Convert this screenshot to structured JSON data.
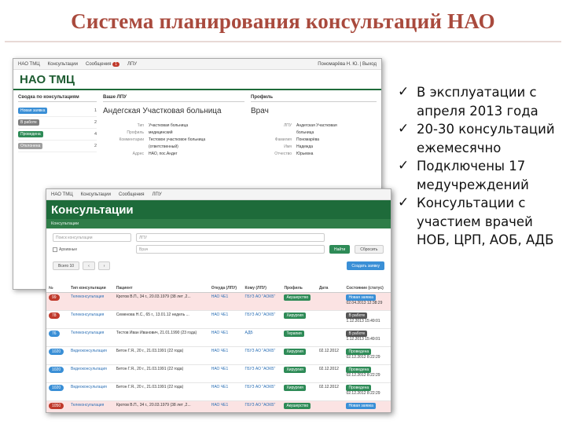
{
  "slide": {
    "title": "Система планирования консультаций НАО"
  },
  "screenshot1": {
    "topbar": {
      "items": [
        "НАО ТМЦ",
        "Консультации",
        "Сообщения",
        "ЛПУ"
      ],
      "messages_count": "1",
      "right": "Пономарёва Н. Ю. | Выход"
    },
    "brand": "НАО ТМЦ",
    "panel_left_title": "Сводка по консультациям",
    "left_rows": [
      {
        "label": "Новая заявка",
        "value": "1",
        "color": "#3a8fd6"
      },
      {
        "label": "В работе",
        "value": "2",
        "color": "#7f7f7f"
      },
      {
        "label": "Проведена",
        "value": "4",
        "color": "#2e8b57"
      },
      {
        "label": "Отклонена",
        "value": "2",
        "color": "#9e9e9e"
      }
    ],
    "panel_mid_title": "Ваше ЛПУ",
    "org_name": "Андегская Участковая больница",
    "org_fields": [
      {
        "k": "Тип",
        "v": "Участковая больница"
      },
      {
        "k": "Профиль",
        "v": "медицинский"
      },
      {
        "k": "Комментарии",
        "v": "Тестовое участковое больница"
      },
      {
        "k": "",
        "v": "(ответственный)"
      },
      {
        "k": "Адрес",
        "v": "НАО, пос.Андег"
      }
    ],
    "panel_right_title": "Профиль",
    "role": "Врач",
    "profile_fields": [
      {
        "k": "ЛПУ",
        "v": "Андегская Участковая"
      },
      {
        "k": "",
        "v": "больница"
      },
      {
        "k": "Фамилия",
        "v": "Пономарёва"
      },
      {
        "k": "Имя",
        "v": "Надежда"
      },
      {
        "k": "Отчество",
        "v": "Юрьевна"
      }
    ]
  },
  "screenshot2": {
    "topbar": {
      "items": [
        "НАО ТМЦ",
        "Консультации",
        "Сообщения",
        "ЛПУ"
      ]
    },
    "brand": "Консультации",
    "subnav": "Консультации",
    "search_placeholder": "Поиск консультации",
    "lpu_placeholder": "ЛПУ",
    "archive_label": "Архивные",
    "doctor_placeholder": "Врач",
    "find_button": "Найти",
    "reset_button": "Сбросить",
    "per_page_label": "Всего 10",
    "add_button": "Создать заявку",
    "columns": [
      "№",
      "Тип консультации",
      "Пациент",
      "Откуда (ЛПУ)",
      "Кому (ЛПУ)",
      "Профиль",
      "Дата",
      "Состояние (статус)"
    ],
    "rows": [
      {
        "id": "99",
        "id_color": "#c0392b",
        "type": "Телеконсультация",
        "patient": "Кротов В.П., 34 г., 20.03.1979 (38 лет ,2...",
        "from": "НАО ЧЕ1",
        "to": "ГБУЗ АО \"АОКБ\"",
        "profile": "Акушерство",
        "date": "",
        "status": "Новая заявка",
        "status_color": "#3a8fd6",
        "status_date": "02.04.2013 12:38:29",
        "pink": true
      },
      {
        "id": "78",
        "id_color": "#c0392b",
        "type": "Телеконсультация",
        "patient": "Семенова Н.С., 65 г., 13.01.12 недель ...",
        "from": "НАО ЧЕ1",
        "to": "ГБУЗ АО \"АОКБ\"",
        "profile": "Хирургия",
        "date": "",
        "status": "В работе",
        "status_color": "#555555",
        "status_date": "1.12.2013 15:49:01",
        "pink": false
      },
      {
        "id": "76",
        "id_color": "#3a8fd6",
        "type": "Телеконсультация",
        "patient": "Тестов Иван Иванович, 21.01.1990 (23 года)",
        "from": "НАО ЧЕ1",
        "to": "АДБ",
        "profile": "Терапия",
        "date": "",
        "status": "В работе",
        "status_color": "#555555",
        "status_date": "1.12.2013 15:49:01",
        "pink": false
      },
      {
        "id": "1020",
        "id_color": "#3a8fd6",
        "type": "Видеоконсультация",
        "patient": "Бетон Г.Я., 20 г., 21.03.1991 (22 года)",
        "from": "НАО ЧЕ1",
        "to": "ГБУЗ АО \"АОКБ\"",
        "profile": "Хирургия",
        "date": "02.12.2012",
        "status": "Проведена",
        "status_color": "#2e8b57",
        "status_date": "02.12.2012 8:22:29",
        "pink": false
      },
      {
        "id": "1020",
        "id_color": "#3a8fd6",
        "type": "Видеоконсультация",
        "patient": "Бетон Г.Я., 20 г., 21.03.1991 (22 года)",
        "from": "НАО ЧЕ1",
        "to": "ГБУЗ АО \"АОКБ\"",
        "profile": "Хирургия",
        "date": "02.12.2012",
        "status": "Проведена",
        "status_color": "#2e8b57",
        "status_date": "02.12.2012 8:22:29",
        "pink": false
      },
      {
        "id": "1020",
        "id_color": "#3a8fd6",
        "type": "Видеоконсультация",
        "patient": "Бетон Г.Я., 20 г., 21.03.1991 (22 года)",
        "from": "НАО ЧЕ1",
        "to": "ГБУЗ АО \"АОКБ\"",
        "profile": "Хирургия",
        "date": "02.12.2012",
        "status": "Проведена",
        "status_color": "#2e8b57",
        "status_date": "02.12.2012 8:22:29",
        "pink": false
      },
      {
        "id": "1050",
        "id_color": "#c0392b",
        "type": "Телеконсультация",
        "patient": "Кротов В.П., 34 г., 20.03.1979 (38 лет ,2...",
        "from": "НАО ЧЕ1",
        "to": "ГБУЗ АО \"АОКБ\"",
        "profile": "Акушерство",
        "date": "",
        "status": "Новая заявка",
        "status_color": "#3a8fd6",
        "status_date": "",
        "pink": true
      }
    ]
  },
  "bullets": [
    "В эксплуатации с апреля 2013 года",
    "20-30 консультаций ежемесячно",
    "Подключены 17 медучреждений",
    "Консультации с участием врачей НОБ, ЦРП, АОБ, АДБ"
  ],
  "check_glyph": "✓"
}
